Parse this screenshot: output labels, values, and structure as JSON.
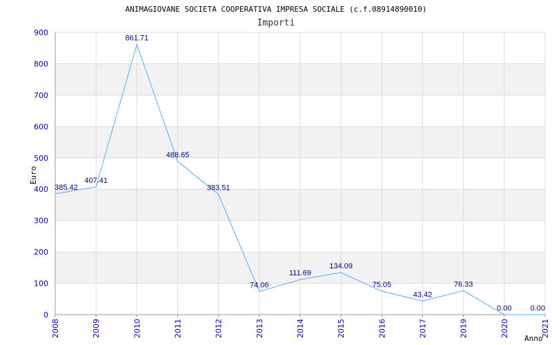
{
  "chart_data": {
    "type": "line",
    "title": "ANIMAGIOVANE SOCIETA COOPERATIVA IMPRESA SOCIALE (c.f.08914890010)",
    "subtitle": "Importi",
    "xlabel": "Anno",
    "ylabel": "Euro",
    "ylim": [
      0,
      900
    ],
    "yticks": [
      0,
      100,
      200,
      300,
      400,
      500,
      600,
      700,
      800,
      900
    ],
    "grid": true,
    "categories": [
      "2008",
      "2009",
      "2010",
      "2011",
      "2012",
      "2013",
      "2014",
      "2015",
      "2016",
      "2017",
      "2019",
      "2020",
      "2021"
    ],
    "series": [
      {
        "values": [
          385.42,
          407.41,
          861.71,
          488.65,
          383.51,
          74.06,
          111.69,
          134.09,
          75.05,
          43.42,
          76.33,
          0.0,
          0.0
        ],
        "labels": [
          "385.42",
          "407.41",
          "861.71",
          "488.65",
          "383.51",
          "74.06",
          "111.69",
          "134.09",
          "75.05",
          "43.42",
          "76.33",
          "0.00",
          "0.00"
        ],
        "color": "#5aaaf0"
      }
    ]
  }
}
